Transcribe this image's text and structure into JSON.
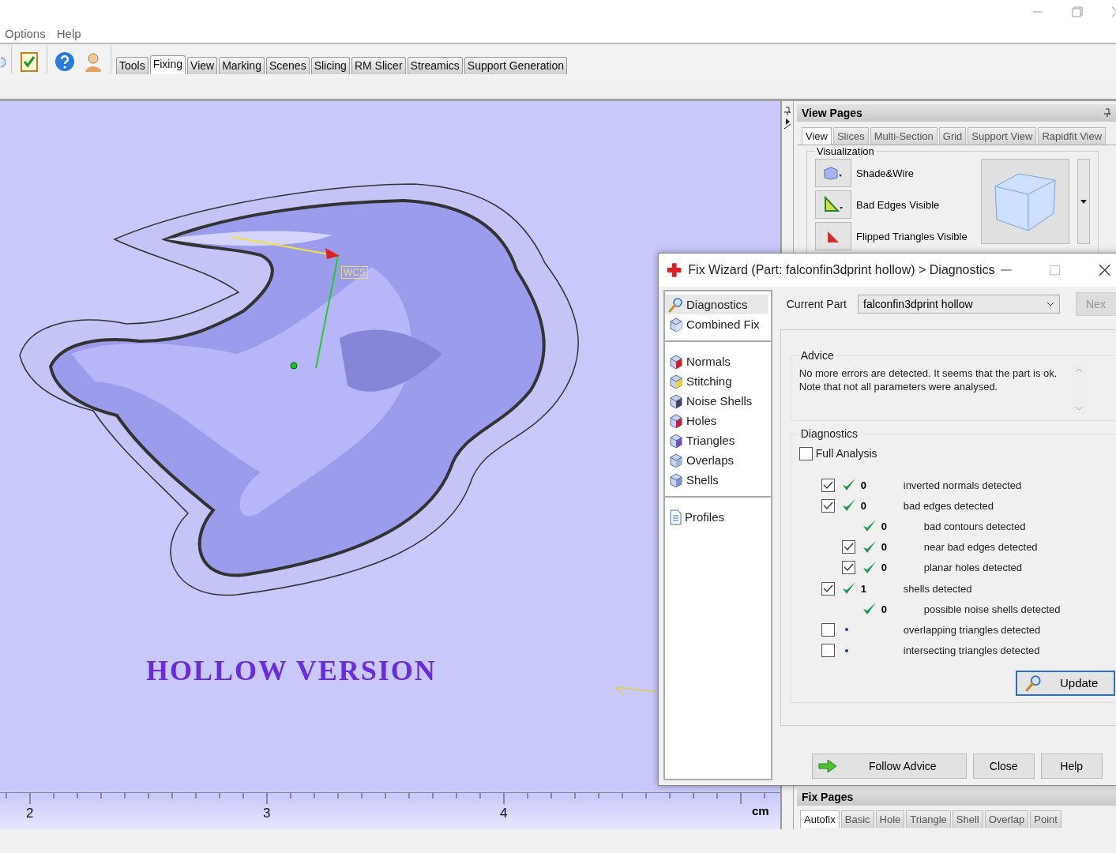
{
  "menu": [
    {
      "label": "Options"
    },
    {
      "label": "Help"
    }
  ],
  "toolbar_tabs": [
    {
      "label": "Tools",
      "selected": false
    },
    {
      "label": "Fixing",
      "selected": true
    },
    {
      "label": "View",
      "selected": false
    },
    {
      "label": "Marking",
      "selected": false
    },
    {
      "label": "Scenes",
      "selected": false
    },
    {
      "label": "Slicing",
      "selected": false
    },
    {
      "label": "RM Slicer",
      "selected": false
    },
    {
      "label": "Streamics",
      "selected": false
    },
    {
      "label": "Support Generation",
      "selected": false
    }
  ],
  "viewport": {
    "caption": "HOLLOW VERSION",
    "axis_label": "WCS",
    "ruler": {
      "ticks": [
        "2",
        "3",
        "4"
      ],
      "unit": "cm"
    }
  },
  "view_pages": {
    "title": "View Pages",
    "tabs": [
      {
        "label": "View",
        "selected": true
      },
      {
        "label": "Slices",
        "selected": false
      },
      {
        "label": "Multi-Section",
        "selected": false
      },
      {
        "label": "Grid",
        "selected": false
      },
      {
        "label": "Support View",
        "selected": false
      },
      {
        "label": "Rapidfit View",
        "selected": false
      }
    ],
    "group": "Visualization",
    "buttons": [
      {
        "label": "Shade&Wire",
        "kind": "shade"
      },
      {
        "label": "Bad Edges Visible",
        "kind": "edges"
      },
      {
        "label": "Flipped Triangles Visible",
        "kind": "flipped"
      }
    ]
  },
  "fix_wizard": {
    "title": "Fix Wizard (Part: falconfin3dprint hollow) > Diagnostics",
    "nav_groups": [
      {
        "items": [
          {
            "label": "Diagnostics",
            "kind": "lens",
            "selected": true
          },
          {
            "label": "Combined Fix",
            "kind": "cube",
            "color": "#d8e4f4",
            "selected": false
          }
        ]
      },
      {
        "items": [
          {
            "label": "Normals",
            "kind": "cube",
            "color": "#d02020",
            "selected": false
          },
          {
            "label": "Stitching",
            "kind": "cube",
            "color": "#f0d040",
            "selected": false
          },
          {
            "label": "Noise Shells",
            "kind": "cube",
            "color": "#404060",
            "selected": false
          },
          {
            "label": "Holes",
            "kind": "cube",
            "color": "#c02040",
            "selected": false
          },
          {
            "label": "Triangles",
            "kind": "cube",
            "color": "#7050c0",
            "selected": false
          },
          {
            "label": "Overlaps",
            "kind": "cube",
            "color": "#a0b8e0",
            "selected": false
          },
          {
            "label": "Shells",
            "kind": "cube",
            "color": "#8090d0",
            "selected": false
          }
        ]
      },
      {
        "items": [
          {
            "label": "Profiles",
            "kind": "document",
            "selected": false
          }
        ]
      }
    ],
    "current_part_label": "Current Part",
    "current_part_value": "falconfin3dprint hollow",
    "next_button": "Nex",
    "advice_title": "Advice",
    "advice_text": "No more errors are detected. It seems that the part is ok. Note that not all parameters were analysed.",
    "diagnostics_title": "Diagnostics",
    "full_analysis": {
      "label": "Full Analysis",
      "checked": false
    },
    "rows": [
      {
        "checked": true,
        "kind": "ok",
        "count": "0",
        "label": "inverted normals detected"
      },
      {
        "checked": true,
        "kind": "ok",
        "count": "0",
        "label": "bad edges detected",
        "children": [
          {
            "kind": "ok",
            "count": "0",
            "label": "bad contours detected"
          },
          {
            "checked": true,
            "kind": "ok",
            "count": "0",
            "label": "near bad edges detected"
          },
          {
            "checked": true,
            "kind": "ok",
            "count": "0",
            "label": "planar holes detected"
          }
        ]
      },
      {
        "checked": true,
        "kind": "ok",
        "count": "1",
        "label": "shells detected",
        "children": [
          {
            "kind": "ok",
            "count": "0",
            "label": "possible noise shells detected"
          }
        ]
      },
      {
        "checked": false,
        "kind": "pending",
        "label": "overlapping triangles detected"
      },
      {
        "checked": false,
        "kind": "pending",
        "label": "intersecting triangles detected"
      }
    ],
    "update_button": "Update",
    "footer_buttons": [
      {
        "label": "Follow Advice",
        "kind": "advice"
      },
      {
        "label": "Close",
        "kind": "plain"
      },
      {
        "label": "Help",
        "kind": "plain"
      }
    ]
  },
  "fix_pages": {
    "title": "Fix Pages",
    "tabs": [
      {
        "label": "Autofix",
        "selected": true
      },
      {
        "label": "Basic",
        "selected": false
      },
      {
        "label": "Hole",
        "selected": false
      },
      {
        "label": "Triangle",
        "selected": false
      },
      {
        "label": "Shell",
        "selected": false
      },
      {
        "label": "Overlap",
        "selected": false
      },
      {
        "label": "Point",
        "selected": false
      }
    ]
  }
}
